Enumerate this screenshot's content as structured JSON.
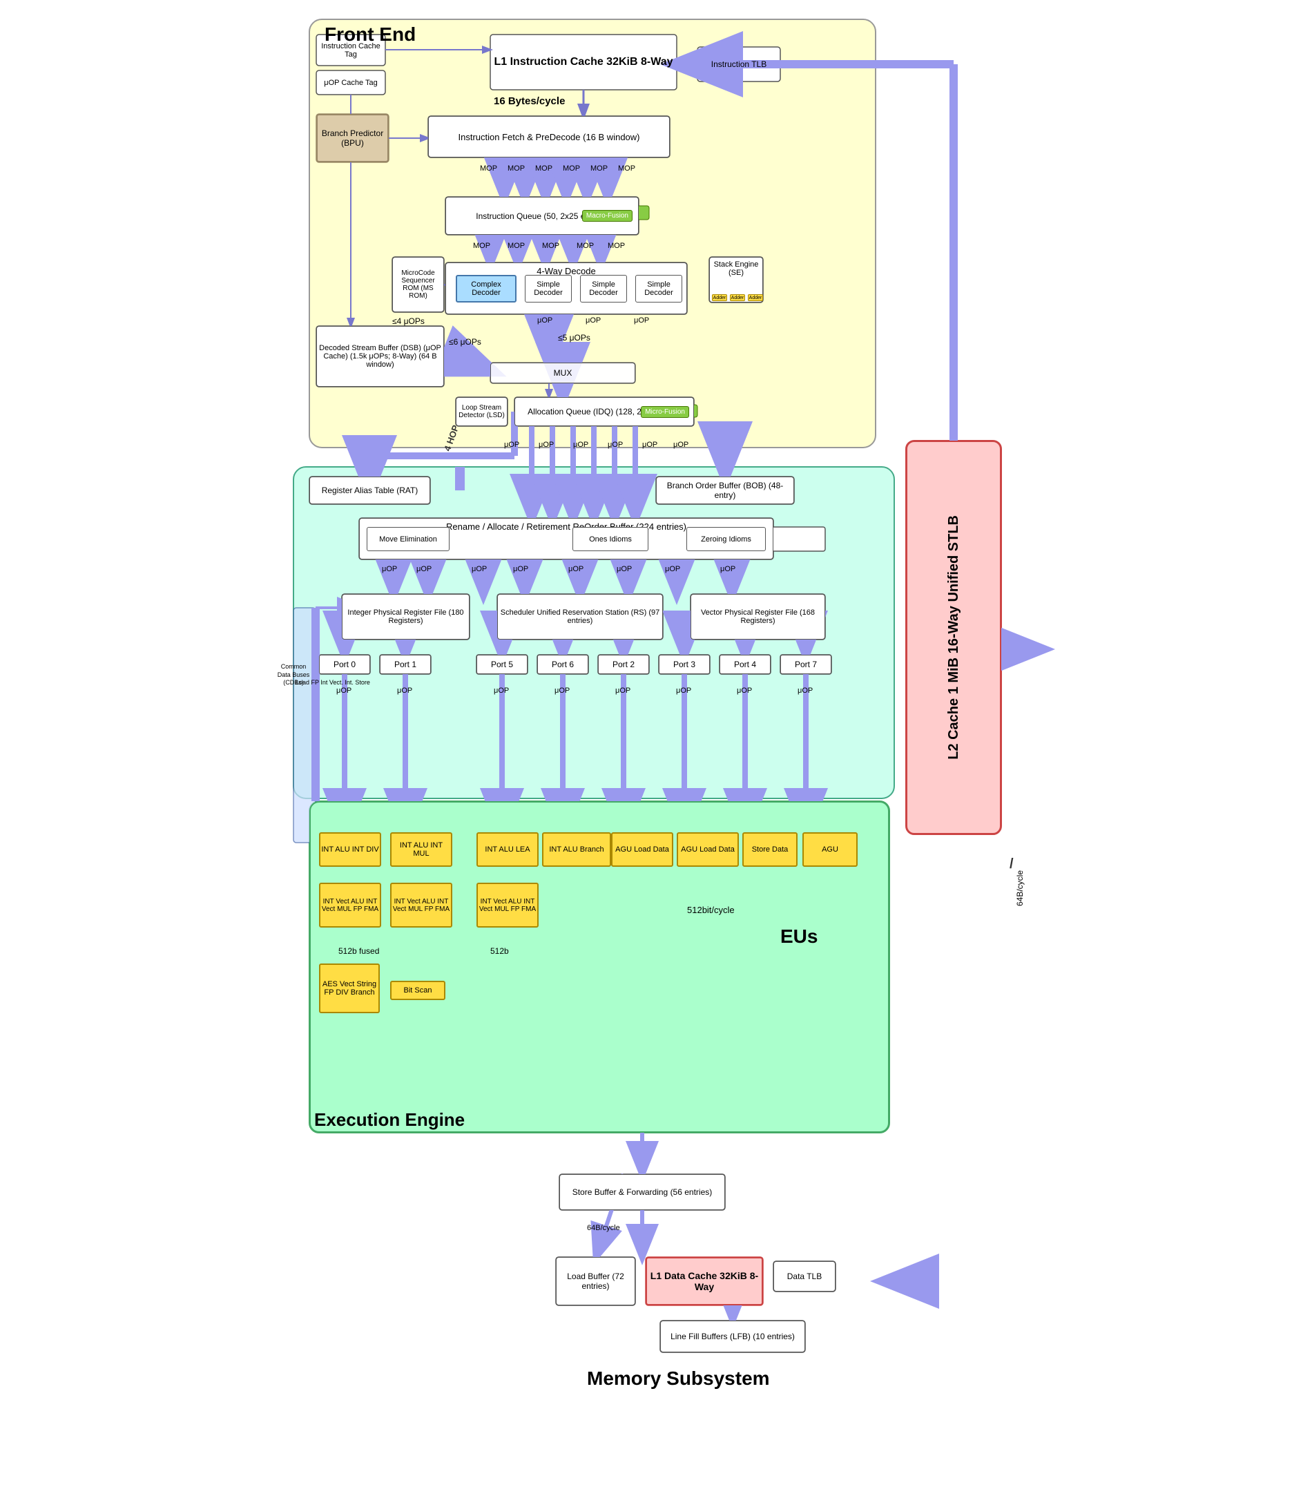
{
  "diagram": {
    "sections": {
      "frontend": {
        "label": "Front End"
      },
      "backend": {
        "label": "Execution Engine"
      },
      "memory": {
        "label": "Memory Subsystem"
      }
    },
    "boxes": {
      "l1_icache": "L1 Instruction\nCache\n32KiB 8-Way",
      "instruction_tlb": "Instruction\nTLB",
      "icache_tag": "Instruction\nCache Tag",
      "uop_cache_tag": "μOP Cache\nTag",
      "branch_predictor": "Branch\nPredictor\n(BPU)",
      "fetch_predecode": "Instruction Fetch & PreDecode\n(16 B window)",
      "instr_queue": "Instruction Queue\n(50, 2x25 entries)",
      "macro_fusion": "Macro-Fusion",
      "decode_4way": "4-Way Decode",
      "complex_decoder": "Complex\nDecoder",
      "simple_decoder1": "Simple\nDecoder",
      "simple_decoder2": "Simple\nDecoder",
      "simple_decoder3": "Simple\nDecoder",
      "microcode_seq": "MicroCode\nSequencer\nROM\n(MS ROM)",
      "stack_engine": "Stack\nEngine\n(SE)",
      "dsb": "Decoded Stream Buffer (DSB)\n(μOP Cache)\n(1.5k μOPs; 8-Way)\n(64 B window)",
      "mux": "MUX",
      "lsd": "Loop Stream\nDetector (LSD)",
      "alloc_queue": "Allocation Queue (IDQ) (128, 2x64 μOPs)",
      "micro_fusion": "Micro-Fusion",
      "rat": "Register Alias Table (RAT)",
      "bob": "Branch Order Buffer\n(BOB) (48-entry)",
      "rename_alloc": "Rename / Allocate / Retirement\nReOrder Buffer (224 entries)",
      "move_elim": "Move Elimination",
      "ones_idioms": "Ones Idioms",
      "zeroing_idioms": "Zeroing Idioms",
      "int_phys_reg": "Integer Physical Register File\n(180 Registers)",
      "scheduler": "Scheduler\nUnified Reservation Station (RS)\n(97 entries)",
      "vec_phys_reg": "Vector Physical Register File\n(168 Registers)",
      "l2_cache": "L2 Cache\n1 MiB 16-Way\nUnified STLB",
      "store_buf": "Store Buffer & Forwarding\n(56 entries)",
      "load_buf": "Load Buffer\n(72 entries)",
      "l1_dcache": "L1 Data Cache\n32KiB 8-Way",
      "data_tlb": "Data TLB",
      "line_fill_buf": "Line Fill Buffers (LFB)\n(10 entries)",
      "adder1": "Adder",
      "adder2": "Adder",
      "adder3": "Adder"
    },
    "ports": {
      "port0": "Port 0",
      "port1": "Port 1",
      "port5": "Port 5",
      "port6": "Port 6",
      "port2": "Port 2",
      "port3": "Port 3",
      "port4": "Port 4",
      "port7": "Port 7"
    },
    "eu_units": {
      "p0_int_alu": "INT ALU\nINT DIV",
      "p1_int_alu": "INT ALU\nINT MUL",
      "p5_int_alu": "INT ALU\nLEA",
      "p6_int_alu": "INT ALU\nBranch",
      "p2_agu": "AGU\nLoad Data",
      "p3_agu": "AGU\nLoad Data",
      "p4_store": "Store Data",
      "p7_agu": "AGU",
      "p0_vec": "INT Vect ALU\nINT Vect MUL\nFP FMA",
      "p1_vec": "INT Vect ALU\nINT Vect MUL\nFP FMA",
      "p5_vec": "INT Vect ALU\nINT Vect MUL\nFP FMA",
      "p0_aes": "AES\nVect String\nFP DIV\nBranch",
      "p1_bitscan": "Bit Scan"
    },
    "labels": {
      "bytes_per_cycle": "16 Bytes/cycle",
      "le4_uops": "≤4 μOPs",
      "le5_uops": "≤5 μOPs",
      "le6_uops": "≤6 μOPs",
      "mop": "MOP",
      "uop": "μOP",
      "hop4": "4 HOP",
      "bit512_cycle": "512bit/cycle",
      "bit64b_cycle": "64B/cycle",
      "bus64b": "64B/cycle",
      "bus64b2": "64B/cycle",
      "64b_per_cycle": "64B/cycle",
      "512b_fused": "512b fused",
      "512b": "512b",
      "common_data_buses": "Common\nData Buses\n(CDBs)",
      "cdbs_loads": "Load\nFP\nInt Vect.\nInt.\nStore"
    }
  }
}
